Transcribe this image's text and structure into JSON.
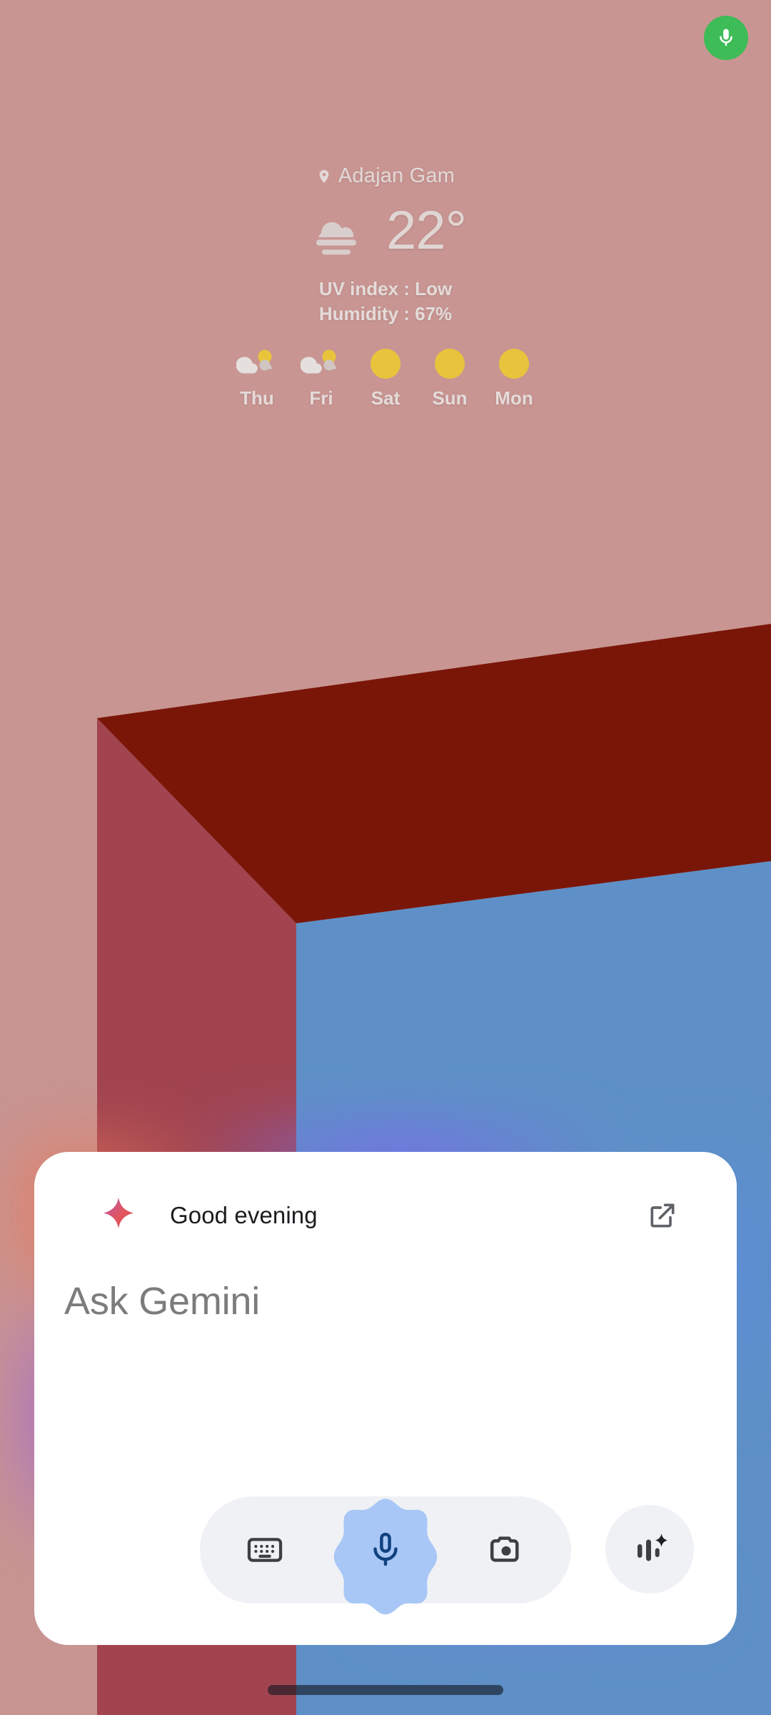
{
  "status": {
    "mic_indicator": {
      "icon": "microphone-icon",
      "color": "#3ebc58",
      "label": "Microphone in use"
    }
  },
  "weather": {
    "location": "Adajan Gam",
    "location_icon": "location-pin-icon",
    "condition_icon": "fog-cloud-icon",
    "temperature": "22°",
    "uv_index": "UV index : Low",
    "humidity": "Humidity : 67%",
    "forecast": [
      {
        "day": "Thu",
        "icon": "partly-cloudy-icon"
      },
      {
        "day": "Fri",
        "icon": "partly-cloudy-icon"
      },
      {
        "day": "Sat",
        "icon": "sunny-icon"
      },
      {
        "day": "Sun",
        "icon": "sunny-icon"
      },
      {
        "day": "Mon",
        "icon": "sunny-icon"
      }
    ]
  },
  "gemini": {
    "sparkle_icon": "gemini-sparkle-icon",
    "greeting": "Good evening",
    "expand_icon": "open-in-new-icon",
    "prompt_placeholder": "Ask Gemini",
    "actions": {
      "keyboard": {
        "icon": "keyboard-icon",
        "label": "Keyboard"
      },
      "mic": {
        "icon": "microphone-icon",
        "label": "Voice input"
      },
      "camera": {
        "icon": "camera-icon",
        "label": "Camera"
      },
      "live": {
        "icon": "gemini-live-bars-icon",
        "label": "Gemini Live"
      }
    }
  },
  "navigation": {
    "gesture_pill": "home-gesture-pill"
  },
  "colors": {
    "wallpaper_background": "#c89592",
    "wallpaper_top_face": "#7a1608",
    "wallpaper_left_face": "#a14450",
    "wallpaper_right_face": "#5e90c7",
    "mic_badge": "#3ebc58",
    "sparkle": "#e2555f",
    "mic_blob": "#a8c7f6",
    "mic_glyph": "#11417e",
    "action_pill": "#eff1f5",
    "sun": "#e8c43c"
  }
}
